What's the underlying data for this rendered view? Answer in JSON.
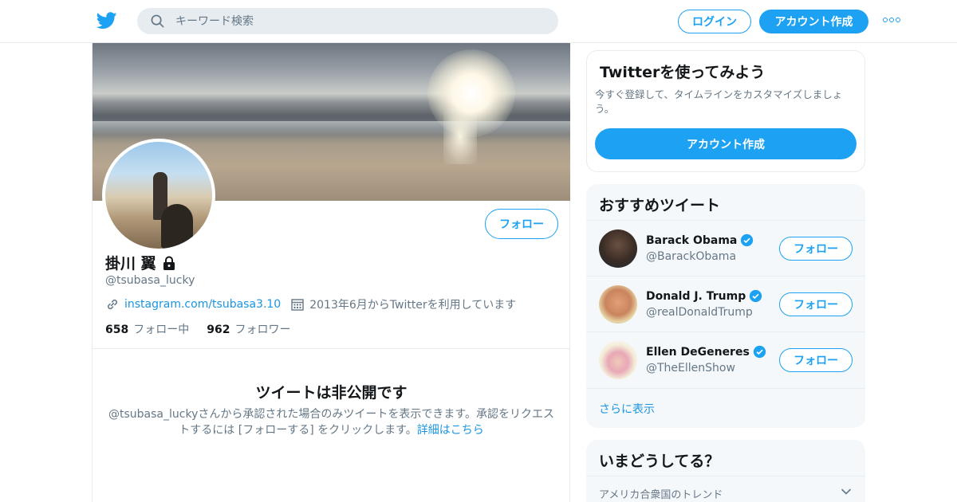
{
  "nav": {
    "search_placeholder": "キーワード検索",
    "login_label": "ログイン",
    "signup_label": "アカウント作成"
  },
  "profile": {
    "display_name": "掛川 翼",
    "handle": "@tsubasa_lucky",
    "follow_label": "フォロー",
    "website": "instagram.com/tsubasa3.10",
    "joined": "2013年6月からTwitterを利用しています",
    "following_count": "658",
    "following_label": "フォロー中",
    "followers_count": "962",
    "followers_label": "フォロワー",
    "protected_title": "ツイートは非公開です",
    "protected_text": "@tsubasa_luckyさんから承認された場合のみツイートを表示できます。承認をリクエストするには [フォローする] をクリックします。",
    "learn_more": "詳細はこちら"
  },
  "signup_card": {
    "title": "Twitterを使ってみよう",
    "subtitle": "今すぐ登録して、タイムラインをカスタマイズしましょう。",
    "cta": "アカウント作成"
  },
  "recommended": {
    "title": "おすすめツイート",
    "follow_label": "フォロー",
    "users": [
      {
        "name": "Barack Obama",
        "handle": "@BarackObama",
        "avatar_color": "#3b3f44"
      },
      {
        "name": "Donald J. Trump",
        "handle": "@realDonaldTrump",
        "avatar_color": "#c9845e"
      },
      {
        "name": "Ellen DeGeneres",
        "handle": "@TheEllenShow",
        "avatar_color": "#e9e2d2"
      }
    ],
    "show_more": "さらに表示"
  },
  "trends": {
    "title": "いまどうしてる？",
    "subtitle": "アメリカ合衆国のトレンド"
  },
  "colors": {
    "brand_blue": "#1da1f2",
    "link_blue": "#1b95e0",
    "muted": "#657786"
  },
  "icons": {
    "logo": "twitter-bird-icon",
    "search": "search-icon",
    "more": "more-dots-icon",
    "lock": "lock-icon",
    "link": "link-icon",
    "calendar": "calendar-icon",
    "verified": "verified-badge-icon",
    "chevron": "chevron-down-icon"
  }
}
